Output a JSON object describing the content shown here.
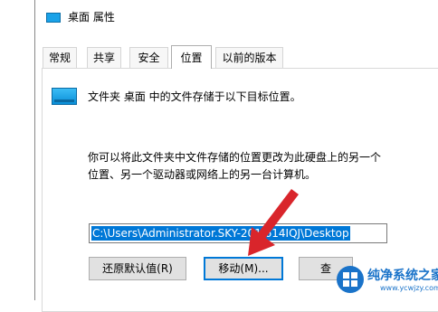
{
  "window": {
    "title": "桌面 属性"
  },
  "tabs": [
    {
      "label": "常规"
    },
    {
      "label": "共享"
    },
    {
      "label": "安全"
    },
    {
      "label": "位置"
    },
    {
      "label": "以前的版本"
    }
  ],
  "location": {
    "header": "文件夹 桌面 中的文件存储于以下目标位置。",
    "desc_line1": "你可以将此文件夹中文件存储的位置更改为此硬盘上的另一个",
    "desc_line2": "位置、另一个驱动器或网络上的另一台计算机。",
    "path": "C:\\Users\\Administrator.SKY-201  614IQJ\\Desktop"
  },
  "buttons": {
    "restore": "还原默认值(R)",
    "move": "移动(M)...",
    "find": "查"
  },
  "watermark": {
    "title": "纯净系统之家",
    "url": "www.ycwjzy.com"
  },
  "colors": {
    "accent": "#0078d7",
    "arrow": "#d9252b",
    "watermark": "#1a73c9"
  },
  "icons": {
    "title": "folder-icon",
    "folder": "folder-icon",
    "pointer": "red-arrow"
  }
}
